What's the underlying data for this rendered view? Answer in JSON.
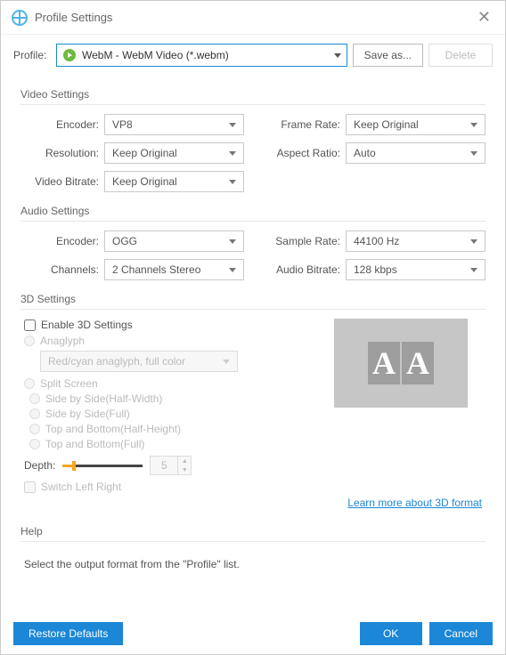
{
  "header": {
    "title": "Profile Settings"
  },
  "profile": {
    "label": "Profile:",
    "value": "WebM - WebM Video (*.webm)",
    "save_as": "Save as...",
    "delete": "Delete"
  },
  "video": {
    "title": "Video Settings",
    "encoder_label": "Encoder:",
    "encoder": "VP8",
    "framerate_label": "Frame Rate:",
    "framerate": "Keep Original",
    "resolution_label": "Resolution:",
    "resolution": "Keep Original",
    "aspect_label": "Aspect Ratio:",
    "aspect": "Auto",
    "bitrate_label": "Video Bitrate:",
    "bitrate": "Keep Original"
  },
  "audio": {
    "title": "Audio Settings",
    "encoder_label": "Encoder:",
    "encoder": "OGG",
    "samplerate_label": "Sample Rate:",
    "samplerate": "44100 Hz",
    "channels_label": "Channels:",
    "channels": "2 Channels Stereo",
    "bitrate_label": "Audio Bitrate:",
    "bitrate": "128 kbps"
  },
  "threed": {
    "title": "3D Settings",
    "enable_label": "Enable 3D Settings",
    "anaglyph_label": "Anaglyph",
    "anaglyph_value": "Red/cyan anaglyph, full color",
    "split_label": "Split Screen",
    "split_options": [
      "Side by Side(Half-Width)",
      "Side by Side(Full)",
      "Top and Bottom(Half-Height)",
      "Top and Bottom(Full)"
    ],
    "depth_label": "Depth:",
    "depth_value": "5",
    "switch_label": "Switch Left Right",
    "learn_more": "Learn more about 3D format"
  },
  "help": {
    "title": "Help",
    "text": "Select the output format from the \"Profile\" list."
  },
  "footer": {
    "restore": "Restore Defaults",
    "ok": "OK",
    "cancel": "Cancel"
  }
}
